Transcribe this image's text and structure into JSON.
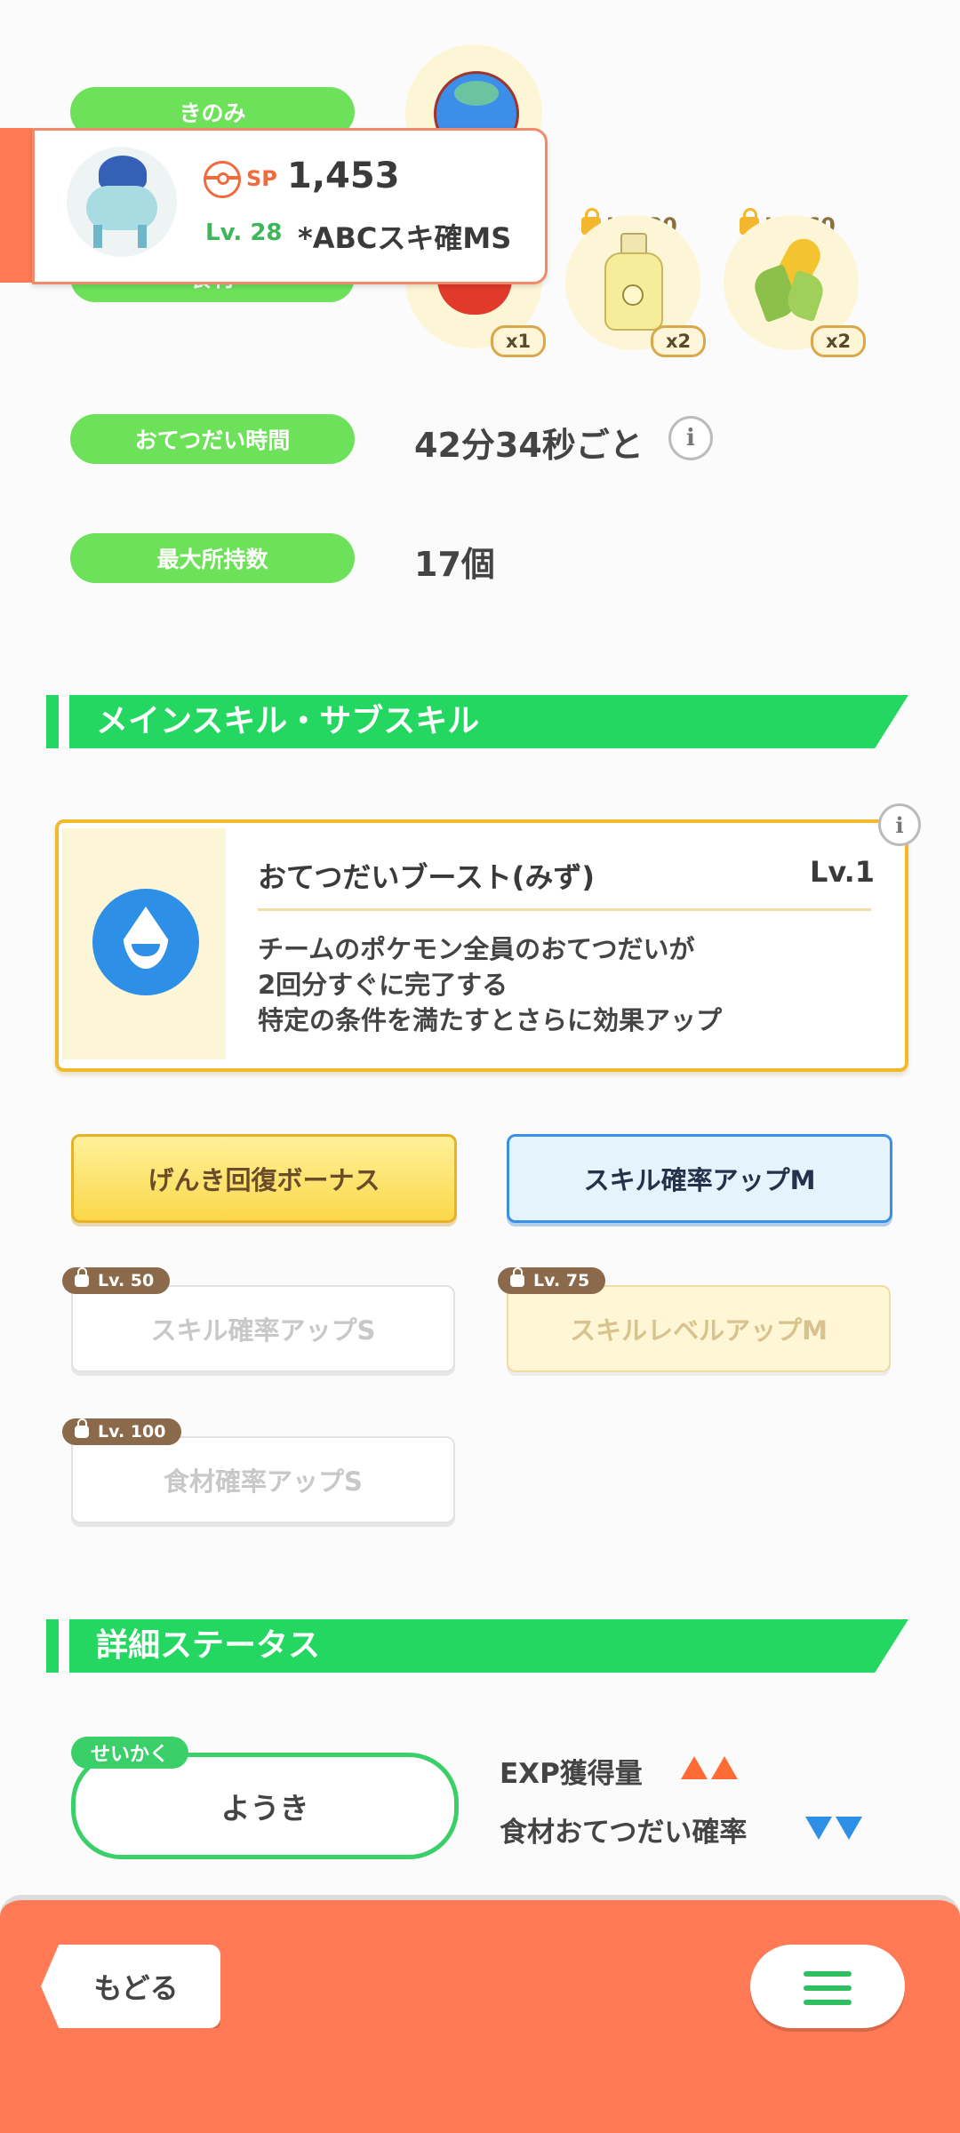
{
  "header": {
    "sp_label": "SP",
    "sp_value": "1,453",
    "level": "Lv. 28",
    "nickname": "*ABCスキ確MS"
  },
  "rows": {
    "berry_label": "きのみ",
    "ingredient_label": "食材",
    "help_time_label": "おてつだい時間",
    "help_time_value": "42分34秒ごと",
    "max_carry_label": "最大所持数",
    "max_carry_value": "17個"
  },
  "ingredients": [
    {
      "name": "tomato-icon",
      "qty": "x1",
      "unlock": ""
    },
    {
      "name": "oil-icon",
      "qty": "x2",
      "unlock": "Lv. 30"
    },
    {
      "name": "corn-icon",
      "qty": "x2",
      "unlock": "Lv. 60"
    }
  ],
  "main_skill_section": {
    "title": "メインスキル・サブスキル"
  },
  "main_skill": {
    "name": "おてつだいブースト(みず)",
    "level": "Lv.1",
    "desc1": "チームのポケモン全員のおてつだいが",
    "desc2": "2回分すぐに完了する",
    "desc3": "特定の条件を満たすとさらに効果アップ"
  },
  "sub_skills": {
    "s1": "げんき回復ボーナス",
    "s2": "スキル確率アップM",
    "s3": "スキル確率アップS",
    "s3_lv": "Lv. 50",
    "s4": "スキルレベルアップM",
    "s4_lv": "Lv. 75",
    "s5": "食材確率アップS",
    "s5_lv": "Lv. 100"
  },
  "detail_section": {
    "title": "詳細ステータス"
  },
  "nature": {
    "tag": "せいかく",
    "value": "ようき",
    "up_label": "EXP獲得量",
    "down_label": "食材おてつだい確率"
  },
  "footer": {
    "back_label": "もどる"
  },
  "colors": {
    "pill_green": "#6de15a",
    "section_green": "#24d760",
    "footer_orange": "#ff7a55",
    "up_arrow": "#ff6b35",
    "down_arrow": "#2e8fe6"
  }
}
